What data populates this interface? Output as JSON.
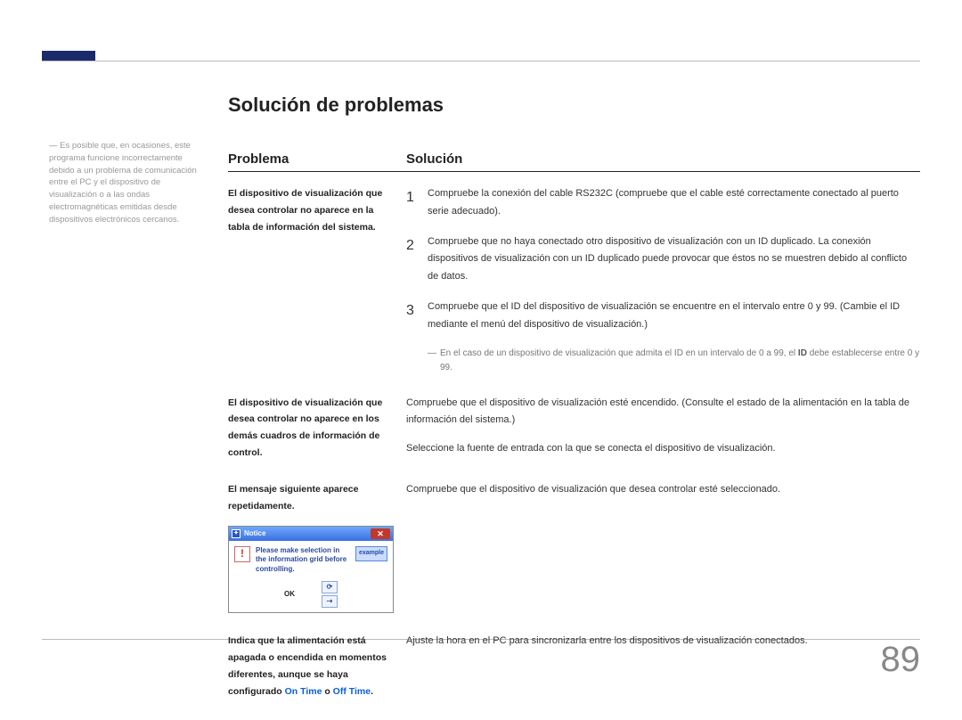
{
  "page_number": "89",
  "heading": "Solución de problemas",
  "sidenote": {
    "dash": "―",
    "text": "Es posible que, en ocasiones, este programa funcione incorrectamente debido a un problema de comunicación entre el PC y el dispositivo de visualización o a las ondas electromagnéticas emitidas desde dispositivos electrónicos cercanos."
  },
  "columns": {
    "problem": "Problema",
    "solution": "Solución"
  },
  "rows": [
    {
      "problem": "El dispositivo de visualización que desea controlar no aparece en la tabla de información del sistema.",
      "items": [
        {
          "n": "1",
          "text": "Compruebe la conexión del cable RS232C (compruebe que el cable esté correctamente conectado al puerto serie adecuado)."
        },
        {
          "n": "2",
          "text": "Compruebe que no haya conectado otro dispositivo de visualización con un ID duplicado. La conexión dispositivos de visualización con un ID duplicado puede provocar que éstos no se muestren debido al conflicto de datos."
        },
        {
          "n": "3",
          "text": "Compruebe que el ID del dispositivo de visualización se encuentre en el intervalo entre 0 y 99. (Cambie el ID mediante el menú del dispositivo de visualización.)"
        }
      ],
      "subnote": {
        "dash": "―",
        "pre": "En el caso de un dispositivo de visualización que admita el ID en un intervalo de 0 a 99, el ",
        "bold": "ID",
        "post": " debe establecerse entre 0 y 99."
      }
    },
    {
      "problem": "El dispositivo de visualización que desea controlar no aparece en los demás cuadros de información de control.",
      "solution_lines": [
        "Compruebe que el dispositivo de visualización esté encendido. (Consulte el estado de la alimentación en la tabla de información del sistema.)",
        "Seleccione la fuente de entrada con la que se conecta el dispositivo de visualización."
      ]
    },
    {
      "problem": "El mensaje siguiente aparece repetidamente.",
      "solution_lines": [
        "Compruebe que el dispositivo de visualización que desea controlar esté seleccionado."
      ],
      "dialog": {
        "title": "Notice",
        "msg": "Please make selection in the information grid before controlling.",
        "example": "example",
        "ok": "OK"
      }
    },
    {
      "problem_main": "Indica que la alimentación está apagada o encendida en momentos diferentes, aunque se haya configurado ",
      "problem_blue1": "On Time",
      "problem_mid": " o ",
      "problem_blue2": "Off Time",
      "problem_end": ".",
      "solution_lines": [
        "Ajuste la hora en el PC para sincronizarla entre los dispositivos de visualización conectados."
      ]
    }
  ]
}
